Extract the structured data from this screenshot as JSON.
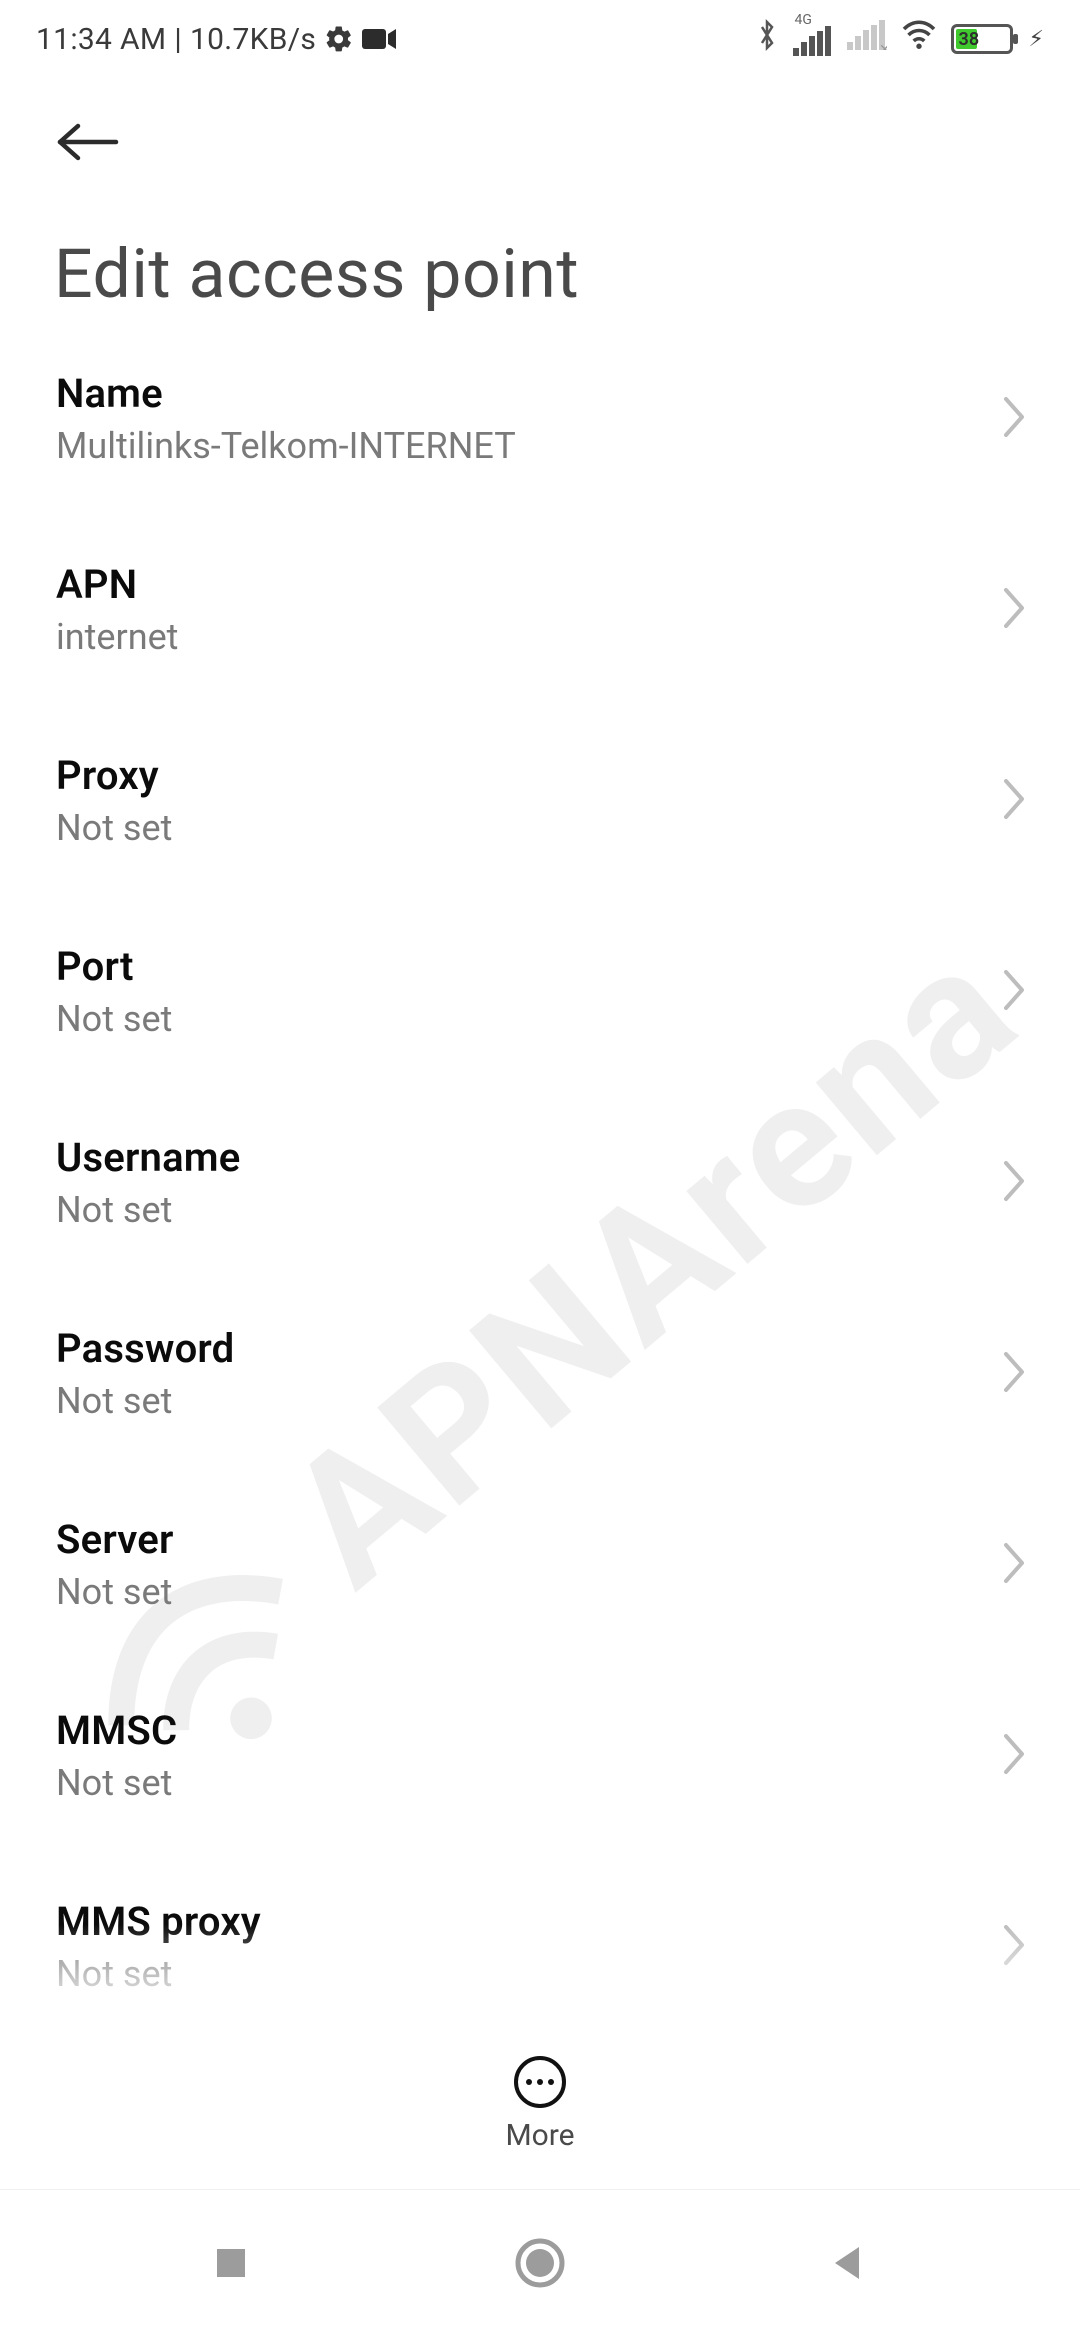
{
  "status": {
    "time": "11:34 AM",
    "separator": "|",
    "net_speed": "10.7KB/s",
    "battery_pct": "38",
    "signal_label_4g": "4G"
  },
  "header": {
    "title": "Edit access point"
  },
  "settings": [
    {
      "label": "Name",
      "value": "Multilinks-Telkom-INTERNET"
    },
    {
      "label": "APN",
      "value": "internet"
    },
    {
      "label": "Proxy",
      "value": "Not set"
    },
    {
      "label": "Port",
      "value": "Not set"
    },
    {
      "label": "Username",
      "value": "Not set"
    },
    {
      "label": "Password",
      "value": "Not set"
    },
    {
      "label": "Server",
      "value": "Not set"
    },
    {
      "label": "MMSC",
      "value": "Not set"
    },
    {
      "label": "MMS proxy",
      "value": "Not set"
    }
  ],
  "action_bar": {
    "more_label": "More"
  },
  "watermark": "APNArena"
}
